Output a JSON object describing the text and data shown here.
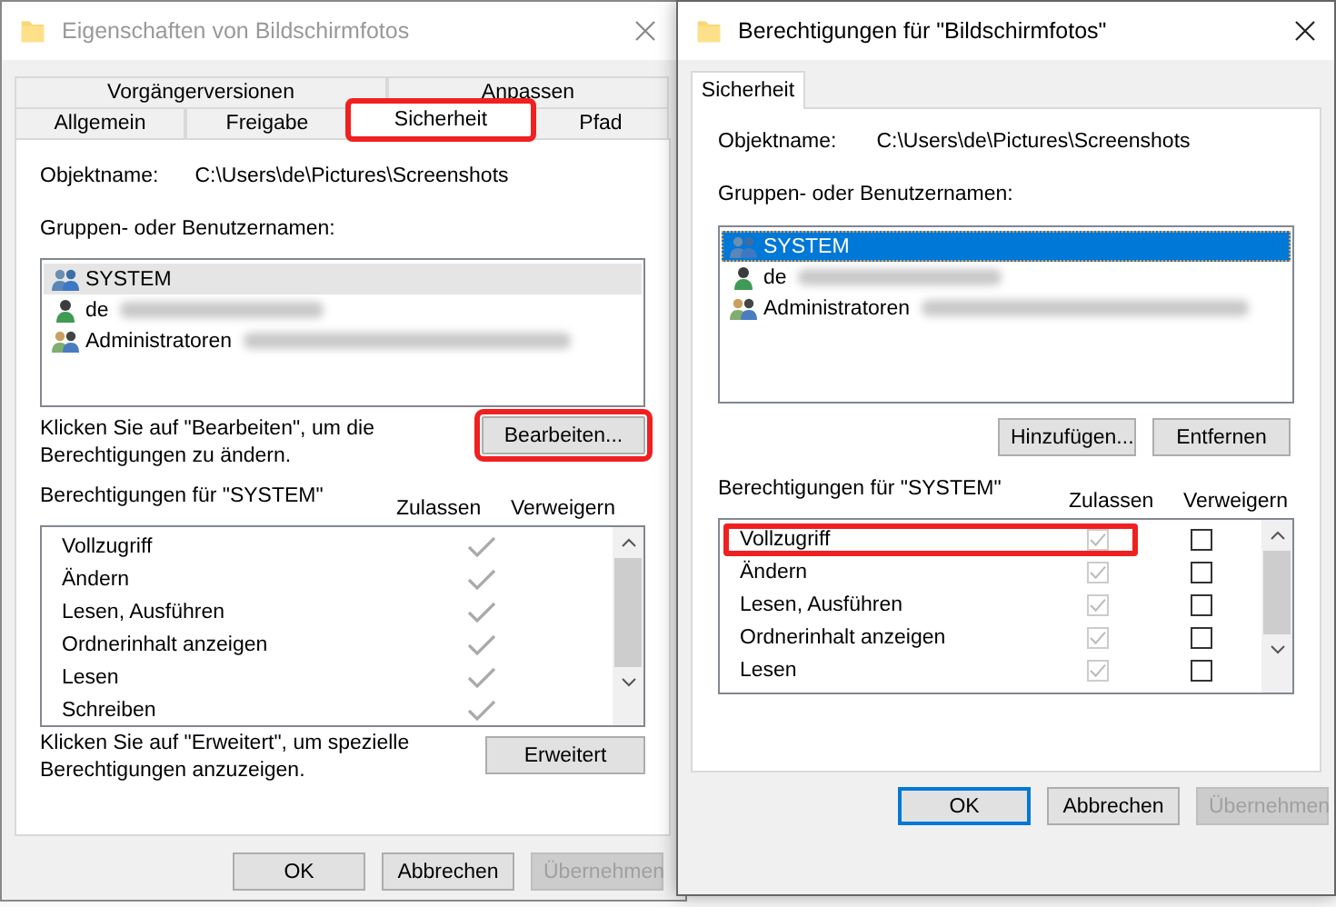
{
  "left_window": {
    "title": "Eigenschaften von Bildschirmfotos",
    "focused": false,
    "tab_rows": [
      [
        {
          "label": "Vorgängerversionen",
          "selected": false,
          "highlighted": false
        },
        {
          "label": "Anpassen",
          "selected": false,
          "highlighted": false
        }
      ],
      [
        {
          "label": "Allgemein",
          "selected": false,
          "highlighted": false
        },
        {
          "label": "Freigabe",
          "selected": false,
          "highlighted": false
        },
        {
          "label": "Sicherheit",
          "selected": true,
          "highlighted": true
        },
        {
          "label": "Pfad",
          "selected": false,
          "highlighted": false
        }
      ]
    ],
    "object_label": "Objektname:",
    "object_path": "C:\\Users\\de\\Pictures\\Screenshots",
    "groups_label": "Gruppen- oder Benutzernamen:",
    "principals": [
      {
        "name": "SYSTEM",
        "kind": "group",
        "selected": true,
        "redacted": false
      },
      {
        "name": "de",
        "kind": "user",
        "selected": false,
        "redacted": true
      },
      {
        "name": "Administratoren",
        "kind": "admins",
        "selected": false,
        "redacted": true
      }
    ],
    "edit_hint": "Klicken Sie auf \"Bearbeiten\", um die Berechtigungen zu ändern.",
    "edit_button": {
      "label": "Bearbeiten...",
      "highlighted": true
    },
    "permissions_label": "Berechtigungen für \"SYSTEM\"",
    "columns": [
      "Zulassen",
      "Verweigern"
    ],
    "permissions": [
      {
        "name": "Vollzugriff",
        "allow": true
      },
      {
        "name": "Ändern",
        "allow": true
      },
      {
        "name": "Lesen, Ausführen",
        "allow": true
      },
      {
        "name": "Ordnerinhalt anzeigen",
        "allow": true
      },
      {
        "name": "Lesen",
        "allow": true
      },
      {
        "name": "Schreiben",
        "allow": true
      }
    ],
    "advanced_hint": "Klicken Sie auf \"Erweitert\", um spezielle Berechtigungen anzuzeigen.",
    "advanced_button": "Erweitert",
    "buttons": [
      {
        "label": "OK",
        "disabled": false,
        "default": false
      },
      {
        "label": "Abbrechen",
        "disabled": false,
        "default": false
      },
      {
        "label": "Übernehmen",
        "disabled": true,
        "default": false
      }
    ]
  },
  "right_window": {
    "title": "Berechtigungen für \"Bildschirmfotos\"",
    "focused": true,
    "tab": {
      "label": "Sicherheit",
      "selected": true
    },
    "object_label": "Objektname:",
    "object_path": "C:\\Users\\de\\Pictures\\Screenshots",
    "groups_label": "Gruppen- oder Benutzernamen:",
    "principals": [
      {
        "name": "SYSTEM",
        "kind": "group",
        "selected": true,
        "redacted": false
      },
      {
        "name": "de",
        "kind": "user",
        "selected": false,
        "redacted": true
      },
      {
        "name": "Administratoren",
        "kind": "admins",
        "selected": false,
        "redacted": true
      }
    ],
    "list_buttons": [
      "Hinzufügen...",
      "Entfernen"
    ],
    "permissions_label": "Berechtigungen für \"SYSTEM\"",
    "columns": [
      "Zulassen",
      "Verweigern"
    ],
    "permissions": [
      {
        "name": "Vollzugriff",
        "allow": true,
        "deny": false,
        "highlighted": true
      },
      {
        "name": "Ändern",
        "allow": true,
        "deny": false,
        "highlighted": false
      },
      {
        "name": "Lesen, Ausführen",
        "allow": true,
        "deny": false,
        "highlighted": false
      },
      {
        "name": "Ordnerinhalt anzeigen",
        "allow": true,
        "deny": false,
        "highlighted": false
      },
      {
        "name": "Lesen",
        "allow": true,
        "deny": false,
        "highlighted": false
      }
    ],
    "buttons": [
      {
        "label": "OK",
        "disabled": false,
        "default": true
      },
      {
        "label": "Abbrechen",
        "disabled": false,
        "default": false
      },
      {
        "label": "Übernehmen",
        "disabled": true,
        "default": false
      }
    ]
  }
}
